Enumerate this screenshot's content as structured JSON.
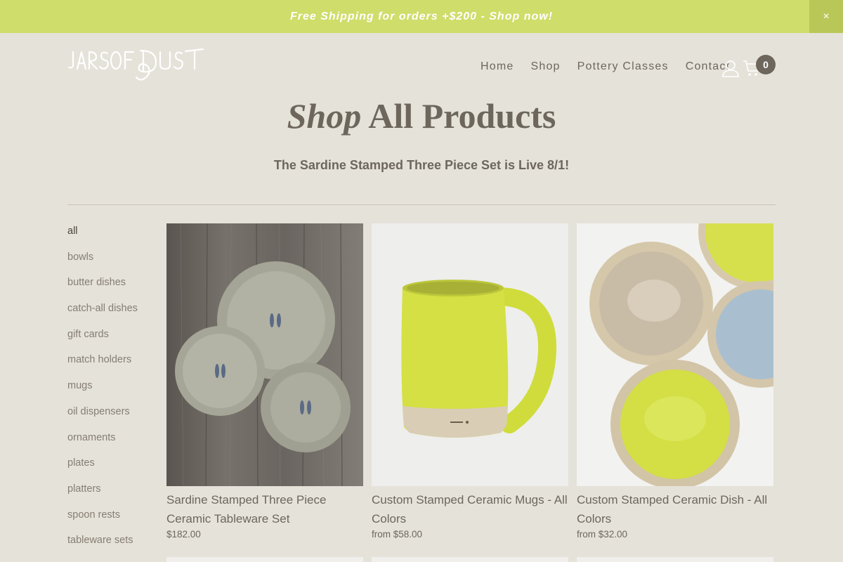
{
  "announcement": {
    "text": "Free Shipping for orders +$200 - Shop now!",
    "close_label": "×"
  },
  "header": {
    "logo_text": "JARS OF DUST",
    "nav": [
      "Home",
      "Shop",
      "Pottery Classes",
      "Contact"
    ],
    "cart_count": "0",
    "icons": [
      "account-icon",
      "cart-icon"
    ]
  },
  "page": {
    "title_italic": "Shop",
    "title_rest": "All Products",
    "subtitle": "The Sardine Stamped Three Piece Set is Live 8/1!"
  },
  "sidebar": {
    "items": [
      {
        "label": "all"
      },
      {
        "label": "bowls"
      },
      {
        "label": "butter dishes"
      },
      {
        "label": "catch-all dishes"
      },
      {
        "label": "gift cards"
      },
      {
        "label": "match holders"
      },
      {
        "label": "mugs"
      },
      {
        "label": "oil dispensers"
      },
      {
        "label": "ornaments"
      },
      {
        "label": "plates"
      },
      {
        "label": "platters"
      },
      {
        "label": "spoon rests"
      },
      {
        "label": "tableware sets"
      }
    ],
    "active": "all"
  },
  "products": [
    {
      "title": "Sardine Stamped Three Piece Ceramic Tableware Set",
      "price": "$182.00"
    },
    {
      "title": "Custom Stamped Ceramic Mugs - All Colors",
      "price": "from $58.00"
    },
    {
      "title": "Custom Stamped Ceramic Dish - All Colors",
      "price": "from $32.00"
    }
  ],
  "colors": {
    "background": "#e5e2da",
    "announcement_bg": "#cfdd6a",
    "text": "#6d665d",
    "chartreuse_glaze": "#d3e04a",
    "blue_glaze": "#a9bfcf"
  }
}
